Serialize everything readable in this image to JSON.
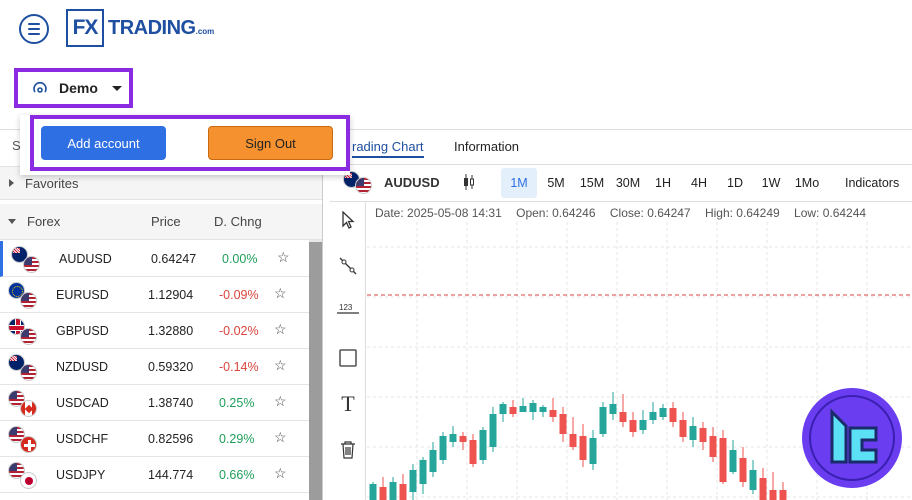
{
  "header": {
    "logo_mark": "FX",
    "logo_name": "TRADING",
    "logo_suffix": ".com"
  },
  "account": {
    "mode": "Demo",
    "dropdown": {
      "add_account": "Add account",
      "sign_out": "Sign Out"
    }
  },
  "strip_letter": "S",
  "tabs": {
    "trading_chart": "rading Chart",
    "information": "Information"
  },
  "watchlist": {
    "favorites_label": "Favorites",
    "group_label": "Forex",
    "col_price": "Price",
    "col_change": "D. Chng",
    "pairs": [
      {
        "symbol": "AUDUSD",
        "price": "0.64247",
        "change": "0.00%",
        "trend": "pos",
        "flag1": "au",
        "flag2": "us"
      },
      {
        "symbol": "EURUSD",
        "price": "1.12904",
        "change": "-0.09%",
        "trend": "neg",
        "flag1": "eu",
        "flag2": "us"
      },
      {
        "symbol": "GBPUSD",
        "price": "1.32880",
        "change": "-0.02%",
        "trend": "neg",
        "flag1": "gb",
        "flag2": "us"
      },
      {
        "symbol": "NZDUSD",
        "price": "0.59320",
        "change": "-0.14%",
        "trend": "neg",
        "flag1": "nz",
        "flag2": "us"
      },
      {
        "symbol": "USDCAD",
        "price": "1.38740",
        "change": "0.25%",
        "trend": "pos",
        "flag1": "us",
        "flag2": "ca"
      },
      {
        "symbol": "USDCHF",
        "price": "0.82596",
        "change": "0.29%",
        "trend": "pos",
        "flag1": "us",
        "flag2": "ch"
      },
      {
        "symbol": "USDJPY",
        "price": "144.774",
        "change": "0.66%",
        "trend": "pos",
        "flag1": "us",
        "flag2": "jp"
      }
    ]
  },
  "chart": {
    "symbol": "AUDUSD",
    "timeframes": [
      "1M",
      "5M",
      "15M",
      "30M",
      "1H",
      "4H",
      "1D",
      "1W",
      "1Mo"
    ],
    "active_timeframe": "1M",
    "indicators_label": "Indicators",
    "ohlc": {
      "date": "Date: 2025-05-08 14:31",
      "open": "Open: 0.64246",
      "close": "Close: 0.64247",
      "high": "High: 0.64249",
      "low": "Low: 0.64244"
    },
    "tools": [
      "cursor-icon",
      "trendline-icon",
      "measure-icon",
      "rectangle-icon",
      "text-icon",
      "trash-icon"
    ],
    "measure_label": "123",
    "text_tool_label": "T",
    "colors": {
      "up": "#26a69a",
      "down": "#ef5350",
      "price_line": "#d9443c"
    }
  }
}
